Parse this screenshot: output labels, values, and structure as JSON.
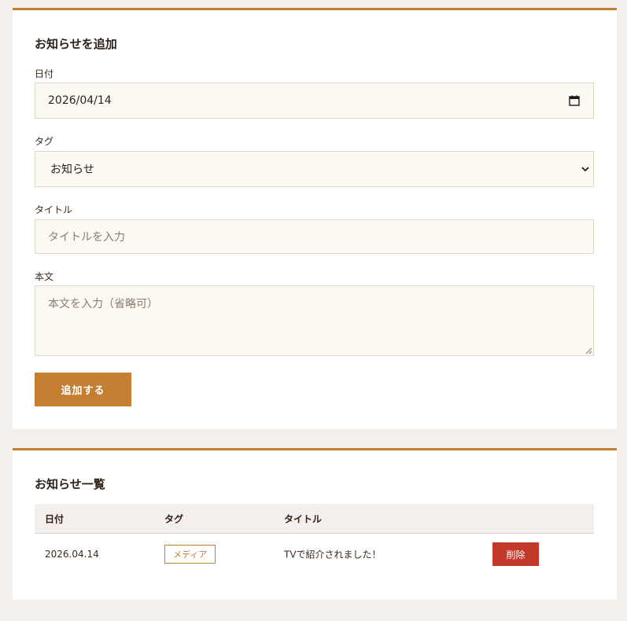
{
  "add_form": {
    "title": "お知らせを追加",
    "date_label": "日付",
    "date_value": "2026/04/14",
    "tag_label": "タグ",
    "tag_selected": "お知らせ",
    "title_label": "タイトル",
    "title_placeholder": "タイトルを入力",
    "body_label": "本文",
    "body_placeholder": "本文を入力（省略可）",
    "submit_label": "追加する"
  },
  "list": {
    "title": "お知らせ一覧",
    "columns": [
      "日付",
      "タグ",
      "タイトル"
    ],
    "rows": [
      {
        "date": "2026.04.14",
        "tag": "メディア",
        "title": "TVで紹介されました！",
        "delete_label": "削除"
      }
    ]
  },
  "colors": {
    "accent": "#c47f32",
    "danger": "#c0392b",
    "page_bg": "#f4efea",
    "input_bg": "#fcf8f2"
  },
  "icons": {
    "date_picker": "calendar-icon",
    "select_dropdown": "chevron-down-icon",
    "textarea_resize": "resize-handle-icon"
  }
}
